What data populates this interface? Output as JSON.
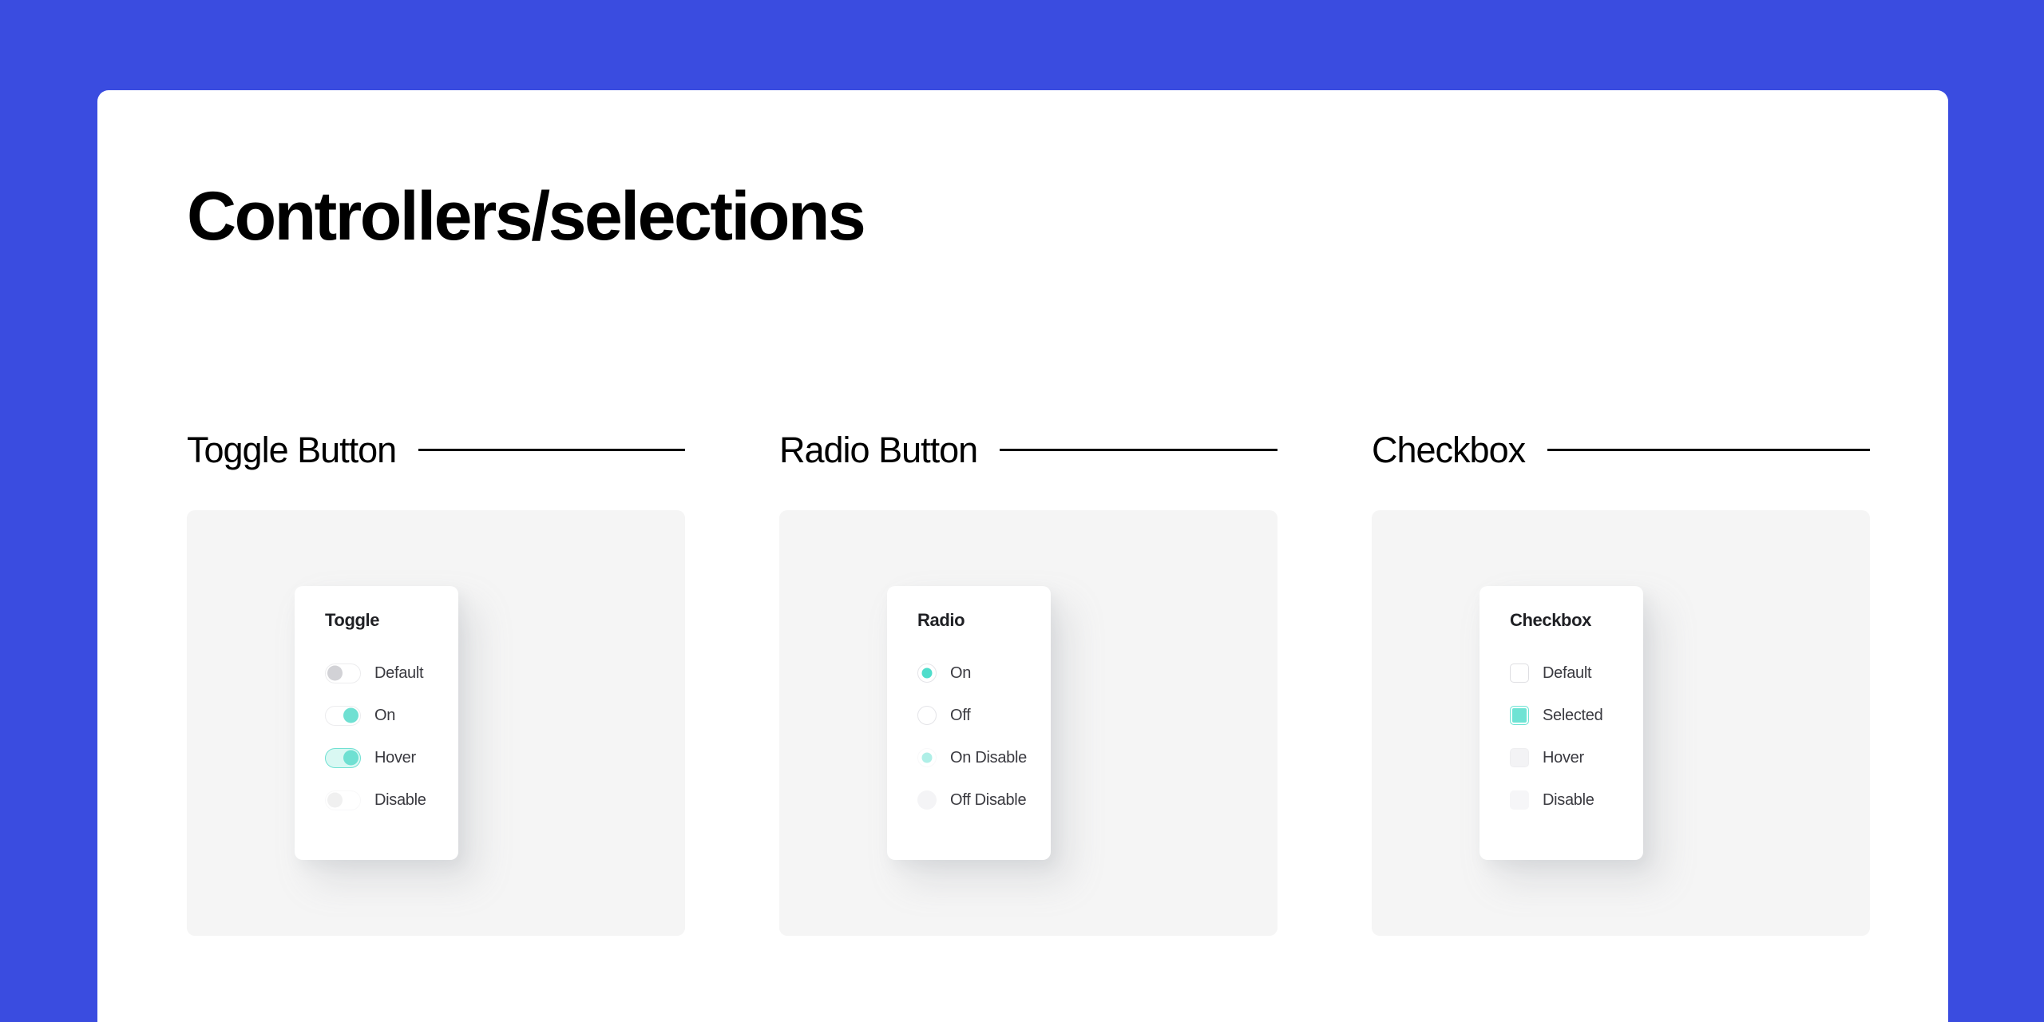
{
  "theme": {
    "background": "#3a4ce0",
    "panel": "#ffffff",
    "stage": "#f5f5f5",
    "accent": "#6fe0d2",
    "accent_soft": "#d9f8f3",
    "text": "#000000",
    "label_text": "#3a3a40",
    "neutral_knob": "#d2d2d6"
  },
  "page": {
    "title": "Controllers/selections"
  },
  "sections": [
    {
      "id": "toggle-button",
      "heading": "Toggle Button",
      "card": {
        "title": "Toggle",
        "options": [
          {
            "label": "Default",
            "state": "default",
            "knob": "left"
          },
          {
            "label": "On",
            "state": "on",
            "knob": "right"
          },
          {
            "label": "Hover",
            "state": "hover",
            "knob": "right"
          },
          {
            "label": "Disable",
            "state": "disable",
            "knob": "left"
          }
        ]
      }
    },
    {
      "id": "radio-button",
      "heading": "Radio Button",
      "card": {
        "title": "Radio",
        "options": [
          {
            "label": "On",
            "state": "on"
          },
          {
            "label": "Off",
            "state": "off"
          },
          {
            "label": "On Disable",
            "state": "on-disable"
          },
          {
            "label": "Off Disable",
            "state": "off-disable"
          }
        ]
      }
    },
    {
      "id": "checkbox",
      "heading": "Checkbox",
      "card": {
        "title": "Checkbox",
        "options": [
          {
            "label": "Default",
            "state": "default"
          },
          {
            "label": "Selected",
            "state": "selected"
          },
          {
            "label": "Hover",
            "state": "hover"
          },
          {
            "label": "Disable",
            "state": "disable"
          }
        ]
      }
    }
  ]
}
